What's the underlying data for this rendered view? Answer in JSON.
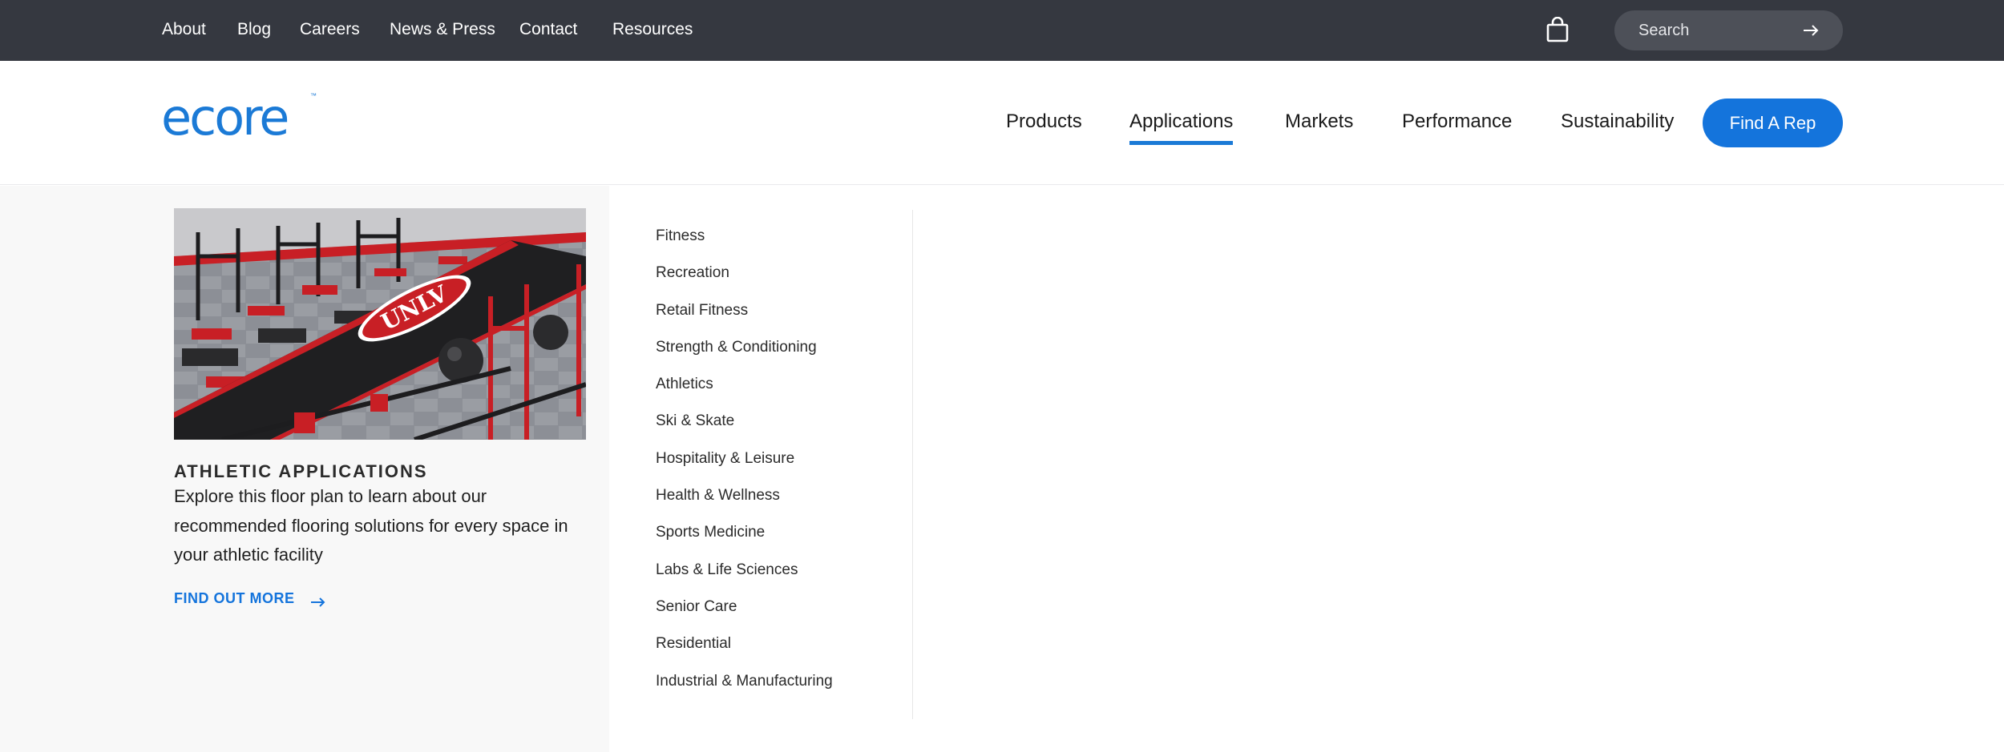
{
  "utility_nav": {
    "links": [
      "About",
      "Blog",
      "Careers",
      "News & Press",
      "Contact",
      "Resources"
    ],
    "search_placeholder": "Search"
  },
  "header": {
    "logo_text": "ecore",
    "logo_tm": "™",
    "nav": [
      "Products",
      "Applications",
      "Markets",
      "Performance",
      "Sustainability"
    ],
    "active_nav": "Applications",
    "cta_label": "Find A Rep"
  },
  "mega_menu": {
    "feature": {
      "title": "ATHLETIC APPLICATIONS",
      "description": "Explore this floor plan to learn about our recommended flooring solutions for every space in your athletic facility",
      "link_label": "FIND OUT MORE",
      "image_wordmark": "UNLV"
    },
    "items": [
      "Fitness",
      "Recreation",
      "Retail Fitness",
      "Strength & Conditioning",
      "Athletics",
      "Ski & Skate",
      "Hospitality & Leisure",
      "Health & Wellness",
      "Sports Medicine",
      "Labs & Life Sciences",
      "Senior Care",
      "Residential",
      "Industrial & Manufacturing"
    ]
  },
  "colors": {
    "topbar_bg": "#353840",
    "accent_blue": "#1474dc",
    "feature_bg": "#f8f8f8"
  }
}
